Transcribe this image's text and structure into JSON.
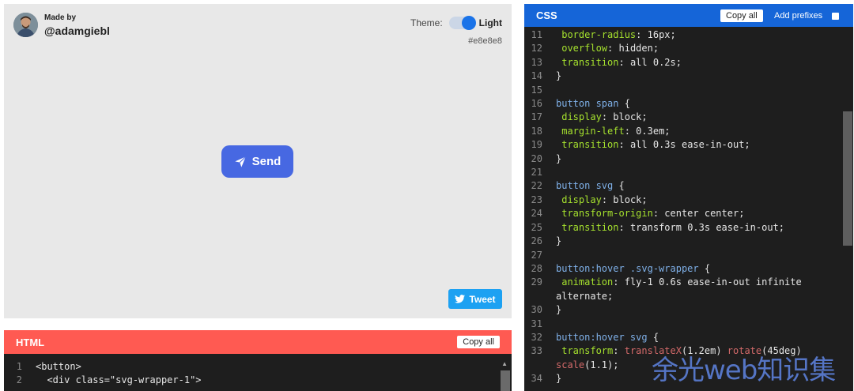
{
  "preview": {
    "made_by_label": "Made by",
    "author_handle": "@adamgiebl",
    "theme_label": "Theme:",
    "theme_value": "Light",
    "background_hex": "#e8e8e8",
    "send_button_label": "Send",
    "tweet_button_label": "Tweet",
    "colors": {
      "send_button": "#4768e2",
      "tweet_button": "#1da1f2",
      "toggle": "#1a73e8"
    }
  },
  "html_panel": {
    "title": "HTML",
    "copy_label": "Copy all",
    "header_color": "#ff5a52",
    "lines": [
      {
        "n": "1",
        "text": "<button>"
      },
      {
        "n": "2",
        "text": "  <div class=\"svg-wrapper-1\">"
      }
    ]
  },
  "css_panel": {
    "title": "CSS",
    "copy_label": "Copy all",
    "prefix_label": "Add prefixes",
    "header_color": "#1565d8",
    "lines": [
      {
        "n": "11",
        "text": " border-radius: 16px;"
      },
      {
        "n": "12",
        "text": " overflow: hidden;"
      },
      {
        "n": "13",
        "text": " transition: all 0.2s;"
      },
      {
        "n": "14",
        "text": "}"
      },
      {
        "n": "15",
        "text": ""
      },
      {
        "n": "16",
        "text": "button span {"
      },
      {
        "n": "17",
        "text": " display: block;"
      },
      {
        "n": "18",
        "text": " margin-left: 0.3em;"
      },
      {
        "n": "19",
        "text": " transition: all 0.3s ease-in-out;"
      },
      {
        "n": "20",
        "text": "}"
      },
      {
        "n": "21",
        "text": ""
      },
      {
        "n": "22",
        "text": "button svg {"
      },
      {
        "n": "23",
        "text": " display: block;"
      },
      {
        "n": "24",
        "text": " transform-origin: center center;"
      },
      {
        "n": "25",
        "text": " transition: transform 0.3s ease-in-out;"
      },
      {
        "n": "26",
        "text": "}"
      },
      {
        "n": "27",
        "text": ""
      },
      {
        "n": "28",
        "text": "button:hover .svg-wrapper {"
      },
      {
        "n": "29",
        "text": " animation: fly-1 0.6s ease-in-out infinite alternate;"
      },
      {
        "n": "30",
        "text": "}"
      },
      {
        "n": "31",
        "text": ""
      },
      {
        "n": "32",
        "text": "button:hover svg {"
      },
      {
        "n": "33",
        "text": " transform: translateX(1.2em) rotate(45deg) scale(1.1);"
      },
      {
        "n": "34",
        "text": "}"
      }
    ]
  },
  "watermark": "余光web知识集"
}
